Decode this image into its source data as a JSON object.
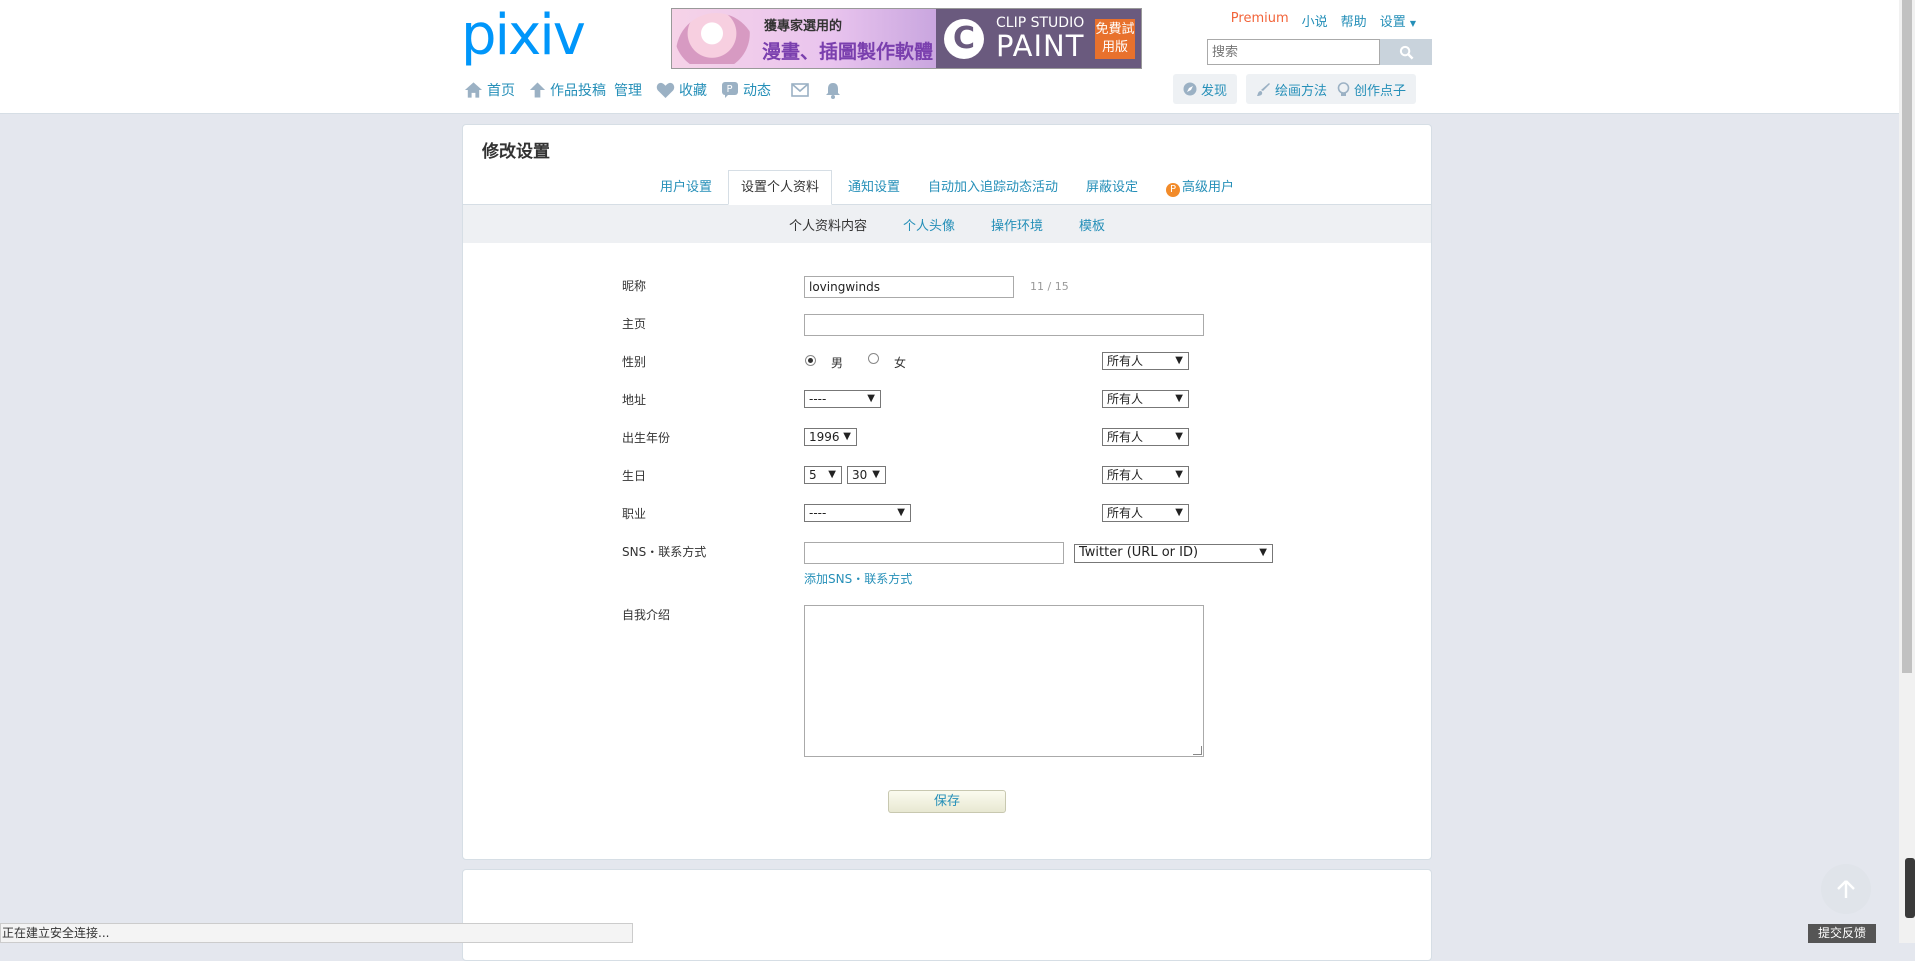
{
  "header": {
    "logo": "pixiv",
    "banner": {
      "line1": "獲專家選用的",
      "line2": "漫畫、插圖製作軟體",
      "brand_top": "CLIP STUDIO",
      "brand_main": "PAINT",
      "badge": "免費試用版"
    },
    "top_links": {
      "premium": "Premium",
      "novel": "小说",
      "help": "帮助",
      "settings": "设置"
    },
    "search": {
      "placeholder": "搜索"
    },
    "nav": {
      "home": "首页",
      "post": "作品投稿",
      "manage": "管理",
      "bookmarks": "收藏",
      "feed": "动态"
    },
    "nav_right": {
      "discover": "发现",
      "howto": "绘画方法",
      "ideas": "创作点子"
    }
  },
  "page": {
    "title": "修改设置",
    "tabs": [
      {
        "label": "用户设置"
      },
      {
        "label": "设置个人资料",
        "active": true
      },
      {
        "label": "通知设置"
      },
      {
        "label": "自动加入追踪动态活动"
      },
      {
        "label": "屏蔽设定"
      },
      {
        "label": "高级用户"
      }
    ],
    "subtabs": [
      {
        "label": "个人资料内容",
        "active": true
      },
      {
        "label": "个人头像"
      },
      {
        "label": "操作环境"
      },
      {
        "label": "模板"
      }
    ]
  },
  "form": {
    "nickname": {
      "label": "昵称",
      "value": "lovingwinds",
      "counter": "11 / 15"
    },
    "homepage": {
      "label": "主页",
      "value": ""
    },
    "gender": {
      "label": "性别",
      "male": "男",
      "female": "女",
      "selected": "男",
      "visibility": "所有人"
    },
    "address": {
      "label": "地址",
      "value": "----",
      "visibility": "所有人"
    },
    "birth_year": {
      "label": "出生年份",
      "value": "1996",
      "visibility": "所有人"
    },
    "birthday": {
      "label": "生日",
      "month": "5",
      "day": "30",
      "visibility": "所有人"
    },
    "job": {
      "label": "职业",
      "value": "----",
      "visibility": "所有人"
    },
    "sns": {
      "label": "SNS・联系方式",
      "value": "",
      "type": "Twitter (URL or ID)",
      "add_link": "添加SNS・联系方式"
    },
    "bio": {
      "label": "自我介绍",
      "value": ""
    },
    "save_label": "保存"
  },
  "status_bar": {
    "text": "正在建立安全连接..."
  },
  "feedback_label": "提交反馈"
}
